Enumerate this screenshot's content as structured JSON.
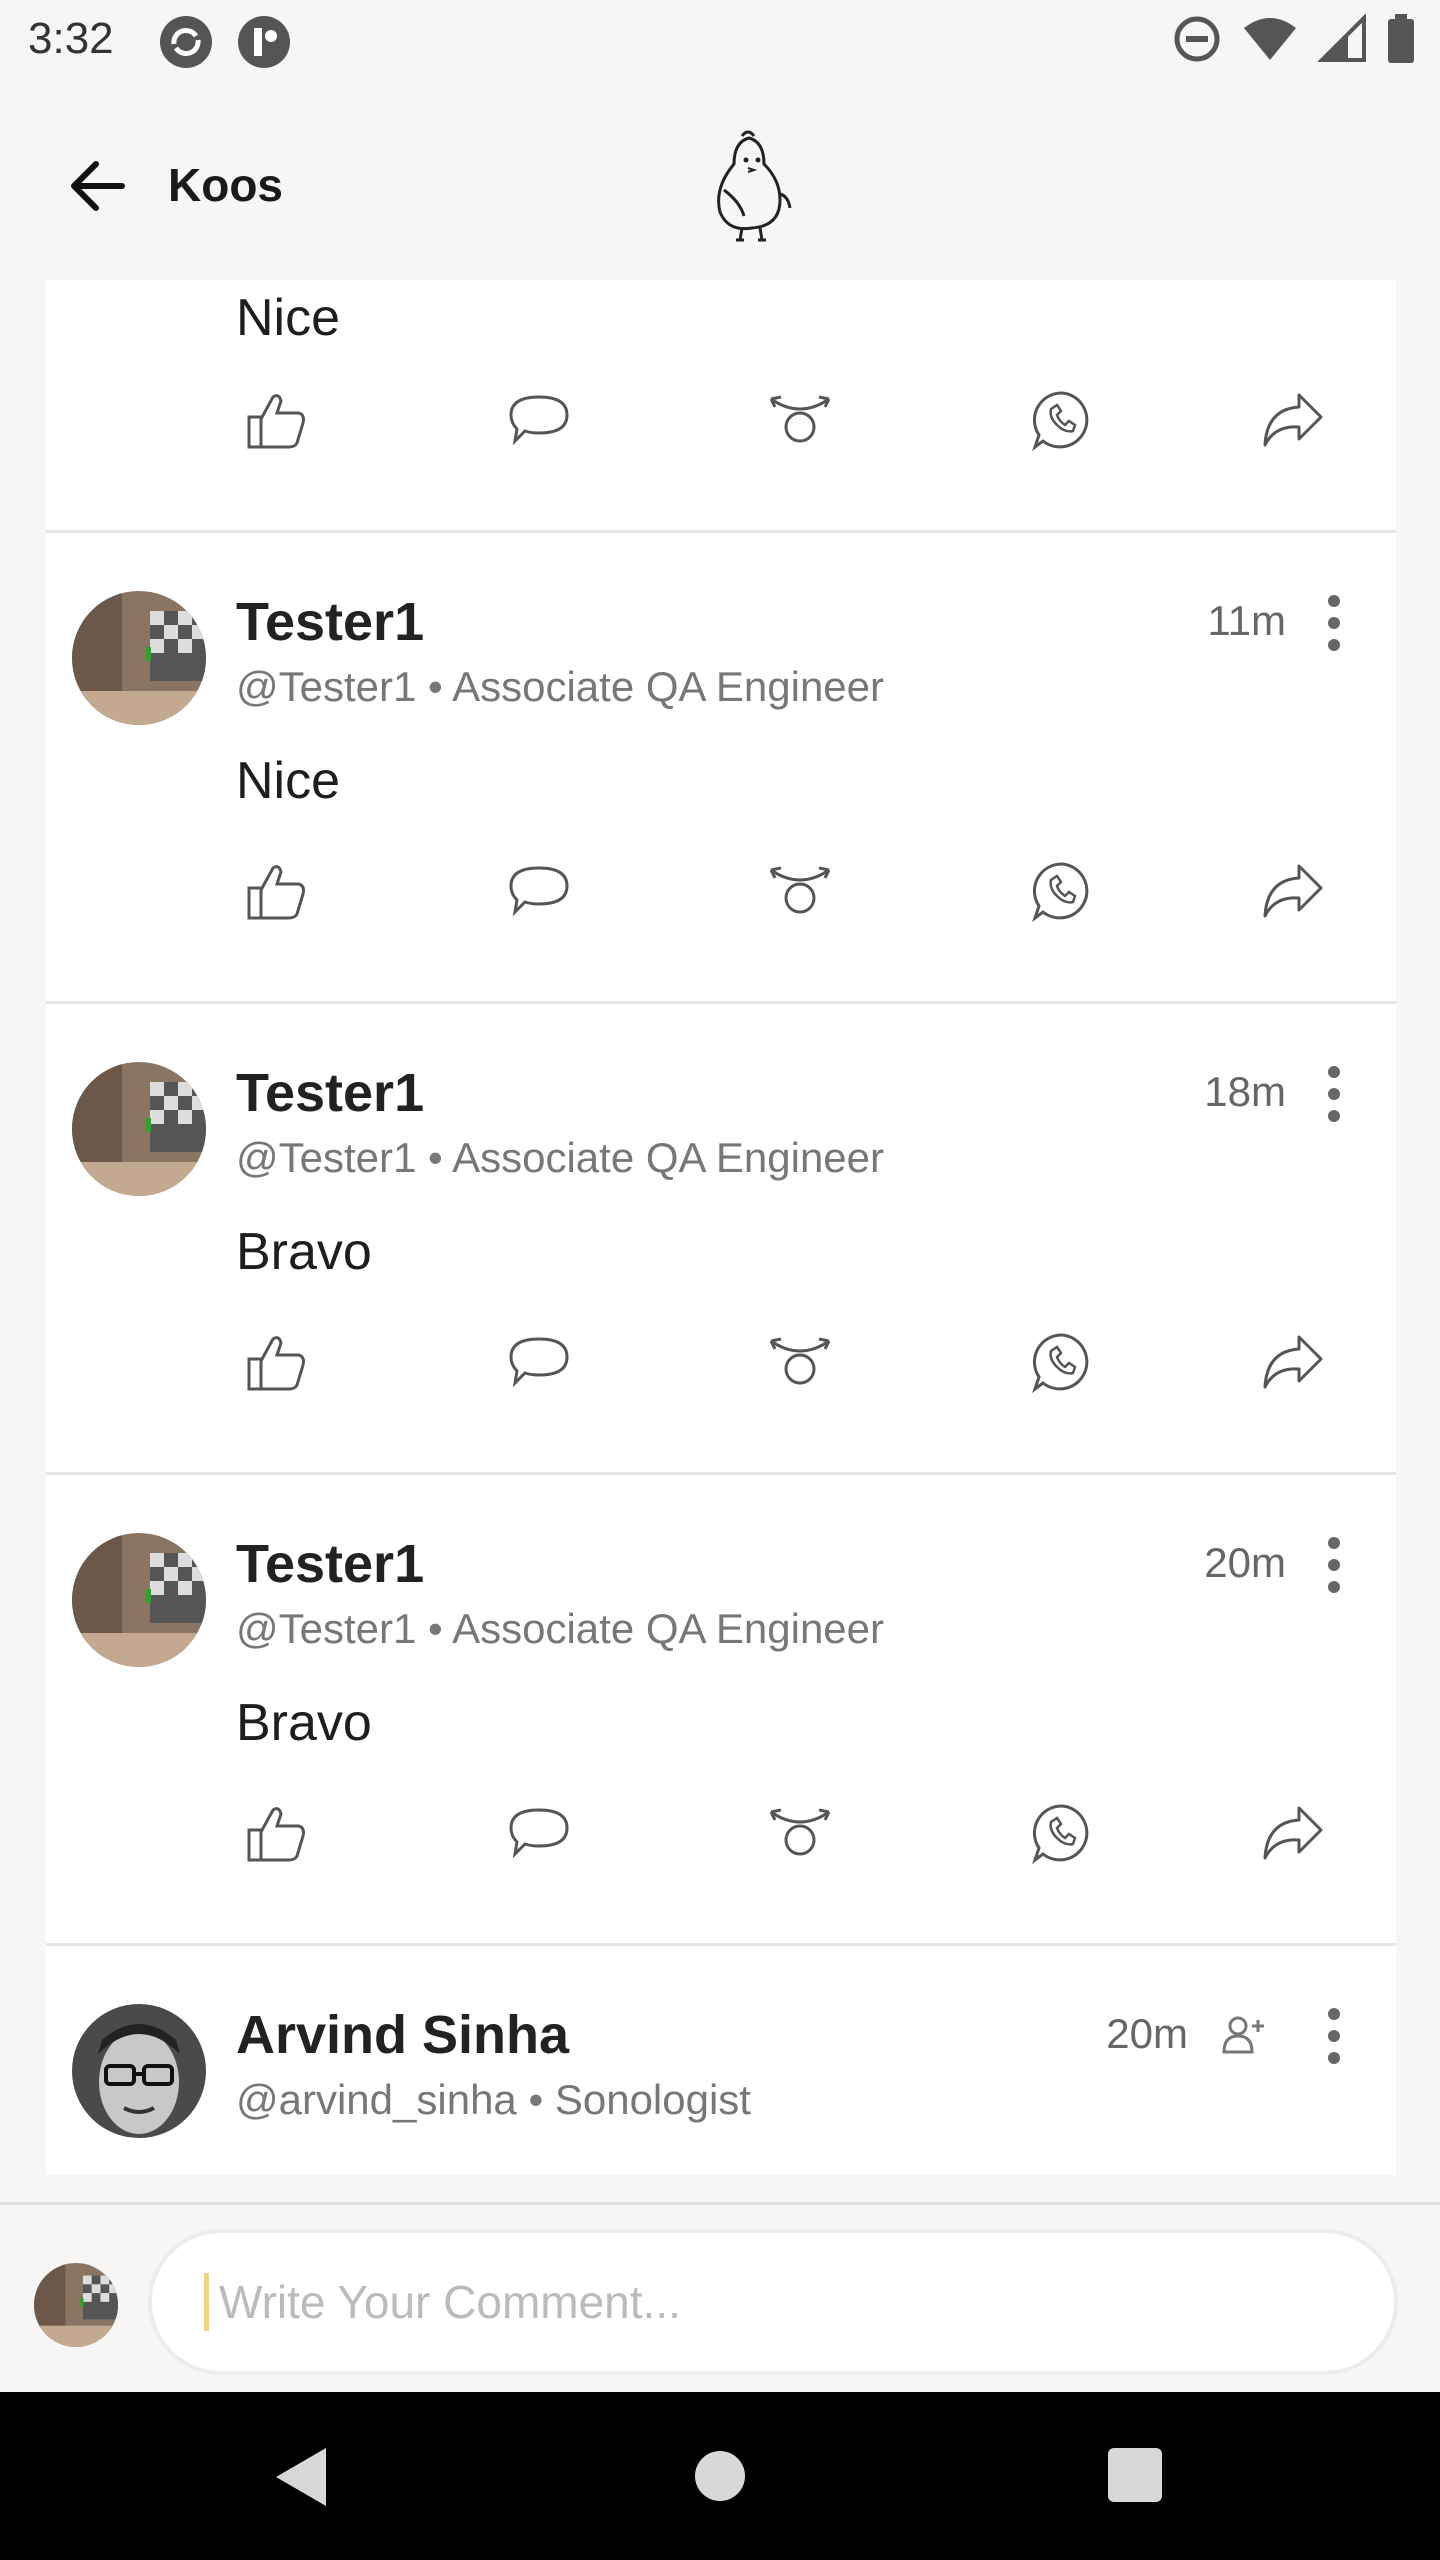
{
  "status_bar": {
    "time": "3:32"
  },
  "app_bar": {
    "title": "Koos"
  },
  "comments": [
    {
      "text": "Nice"
    },
    {
      "name": "Tester1",
      "handle": "@Tester1 • Associate QA Engineer",
      "time": "11m",
      "text": "Nice"
    },
    {
      "name": "Tester1",
      "handle": "@Tester1 • Associate QA Engineer",
      "time": "18m",
      "text": "Bravo"
    },
    {
      "name": "Tester1",
      "handle": "@Tester1 • Associate QA Engineer",
      "time": "20m",
      "text": "Bravo"
    },
    {
      "name": "Arvind Sinha",
      "handle": "@arvind_sinha • Sonologist",
      "time": "20m"
    }
  ],
  "comment_box": {
    "placeholder": "Write Your Comment..."
  },
  "icons": [
    "back-arrow-icon",
    "koo-bird-logo",
    "like-icon",
    "comment-icon",
    "rekoo-icon",
    "whatsapp-icon",
    "share-icon",
    "more-icon",
    "follow-icon"
  ]
}
